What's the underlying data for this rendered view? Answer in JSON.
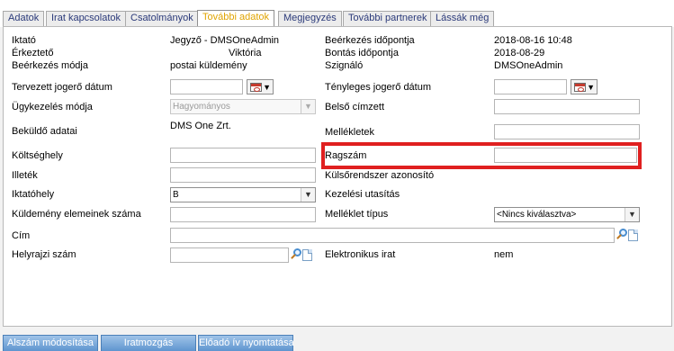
{
  "tabs": [
    "Adatok",
    "Irat kapcsolatok",
    "Csatolmányok",
    "További adatok",
    "Megjegyzés",
    "További partnerek",
    "Lássák még"
  ],
  "active_tab": "További adatok",
  "fields": {
    "iktato": {
      "label": "Iktató",
      "value": "Jegyző - DMSOneAdmin"
    },
    "erkezteto": {
      "label": "Érkeztető",
      "value": "Viktória"
    },
    "erkezes_modja": {
      "label": "Beérkezés módja",
      "value": "postai küldemény"
    },
    "tervezett_jogero": {
      "label": "Tervezett jogerő dátum",
      "value": ""
    },
    "ugykezeles_modja": {
      "label": "Ügykezelés módja",
      "value": "Hagyományos"
    },
    "bekuldo_adatai": {
      "label": "Beküldő adatai",
      "value": "DMS One Zrt."
    },
    "koltseghely": {
      "label": "Költséghely",
      "value": ""
    },
    "illetek": {
      "label": "Illeték",
      "value": ""
    },
    "iktatohely": {
      "label": "Iktatóhely",
      "value": "B"
    },
    "kuldemeny_elemeinek_szama": {
      "label": "Küldemény elemeinek száma",
      "value": ""
    },
    "cim": {
      "label": "Cím",
      "value": ""
    },
    "helyrajzi_szam": {
      "label": "Helyrajzi szám",
      "value": ""
    },
    "beerkezes_idopontja": {
      "label": "Beérkezés időpontja",
      "value": "2018-08-16 10:48"
    },
    "bontas_idopontja": {
      "label": "Bontás időpontja",
      "value": "2018-08-29"
    },
    "szignalo": {
      "label": "Szignáló",
      "value": "DMSOneAdmin"
    },
    "tenyleges_jogero": {
      "label": "Tényleges jogerő dátum",
      "value": ""
    },
    "belso_cimzett": {
      "label": "Belső címzett",
      "value": ""
    },
    "mellekletek": {
      "label": "Mellékletek",
      "value": ""
    },
    "ragszam": {
      "label": "Ragszám",
      "value": ""
    },
    "kulsorendszer_azonosito": {
      "label": "Külsőrendszer azonosító",
      "value": ""
    },
    "kezelesi_utasitas": {
      "label": "Kezelési utasítás",
      "value": ""
    },
    "melleklet_tipus": {
      "label": "Melléklet típus",
      "value": "<Nincs kiválasztva>"
    },
    "elektronikus_irat": {
      "label": "Elektronikus irat",
      "value": "nem"
    }
  },
  "bottom_buttons": [
    "Alszám módosítása",
    "Iratmozgás",
    "Előadó ív nyomtatása"
  ],
  "colors": {
    "active_tab_text": "#e0a400",
    "tab_text": "#2b3a7a",
    "highlight": "#e02020",
    "button_bg": "#6b9fd4"
  }
}
